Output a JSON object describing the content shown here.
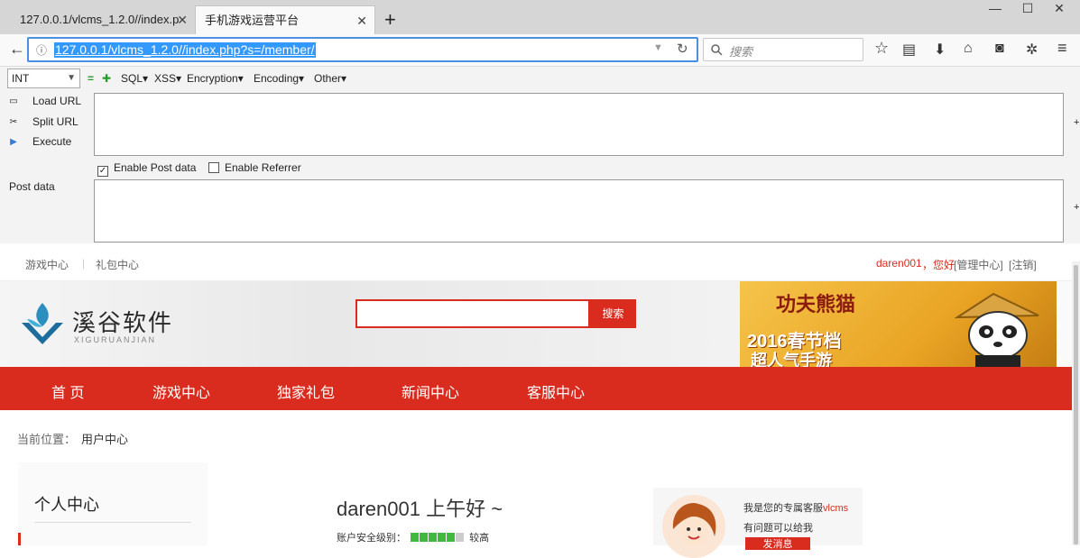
{
  "browser": {
    "tabs": [
      {
        "label": "127.0.0.1/vlcms_1.2.0//index.p"
      },
      {
        "label": "手机游戏运营平台"
      }
    ],
    "url": "127.0.0.1/vlcms_1.2.0//index.php?s=/member/",
    "search_placeholder": "搜索"
  },
  "hackbar": {
    "select_value": "INT",
    "menus": [
      "SQL",
      "XSS",
      "Encryption",
      "Encoding",
      "Other"
    ],
    "actions": [
      "Load URL",
      "Split URL",
      "Execute"
    ],
    "enable_post_label": "Enable Post data",
    "enable_referrer_label": "Enable Referrer",
    "post_data_label": "Post data",
    "enable_post_checked": true,
    "enable_referrer_checked": false
  },
  "site": {
    "topnav": {
      "left_links": [
        "游戏中心",
        "礼包中心"
      ],
      "username": "daren001",
      "greeting": "，您好",
      "admin_link": "[管理中心]",
      "logout_link": "[注销]"
    },
    "logo": {
      "name": "溪谷软件",
      "sub": "XIGURUANJIAN"
    },
    "search_button": "搜索",
    "banner": {
      "line1": "功夫熊猫",
      "line2": "2016春节档",
      "line3": "超人气手游"
    },
    "nav": [
      "首 页",
      "游戏中心",
      "独家礼包",
      "新闻中心",
      "客服中心"
    ],
    "breadcrumb_label": "当前位置：",
    "breadcrumb_value": "用户中心",
    "sidebar_title": "个人中心",
    "greeting_main": "daren001 上午好 ~",
    "security_label": "账户安全级别：",
    "security_level_text": "较高",
    "security_level_fraction": 0.83,
    "service": {
      "line1_prefix": "我是您的专属客服",
      "line1_name": "vlcms",
      "line2": "有问题可以给我",
      "button": "发消息"
    }
  },
  "colors": {
    "accent_red": "#d92c1e",
    "url_highlight": "#3399ff",
    "security_green": "#3fb93f"
  }
}
